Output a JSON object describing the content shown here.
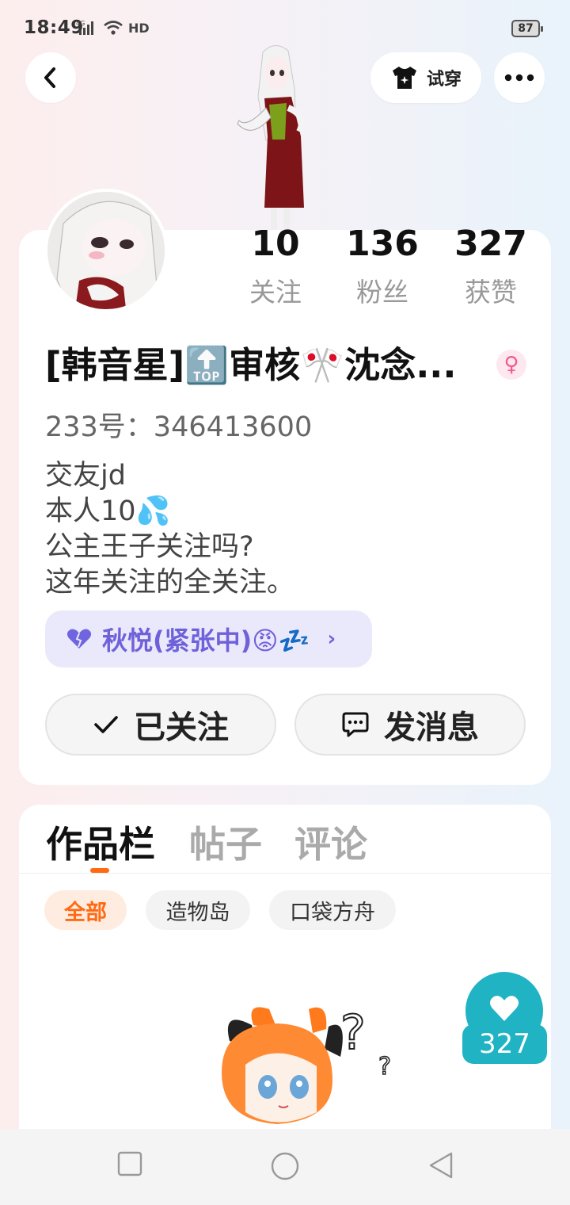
{
  "status_bar": {
    "time": "18:49",
    "battery": "87",
    "network": "4G",
    "hd": "HD"
  },
  "header": {
    "tryon_label": "试穿"
  },
  "stats": {
    "following": {
      "value": "10",
      "label": "关注"
    },
    "fans": {
      "value": "136",
      "label": "粉丝"
    },
    "likes": {
      "value": "327",
      "label": "获赞"
    }
  },
  "profile": {
    "name": "[韩音星]🔝审核🎌沈念...",
    "gender_symbol": "♀",
    "uid": "233号：346413600",
    "bio": [
      "交友jd",
      "本人10💦",
      "公主王子关注吗?",
      "这年关注的全关注。"
    ],
    "status_text": "秋悦(紧张中)😡💤"
  },
  "actions": {
    "followed_label": "已关注",
    "message_label": "发消息"
  },
  "tabs": [
    {
      "label": "作品栏",
      "active": true
    },
    {
      "label": "帖子",
      "active": false
    },
    {
      "label": "评论",
      "active": false
    }
  ],
  "filters": [
    {
      "label": "全部",
      "active": true
    },
    {
      "label": "造物岛",
      "active": false
    },
    {
      "label": "口袋方舟",
      "active": false
    }
  ],
  "like_fab": {
    "count": "327"
  },
  "colors": {
    "accent_orange": "#ff6a13",
    "pill_purple": "#6f61d9",
    "like_teal": "#1fb3c4"
  }
}
